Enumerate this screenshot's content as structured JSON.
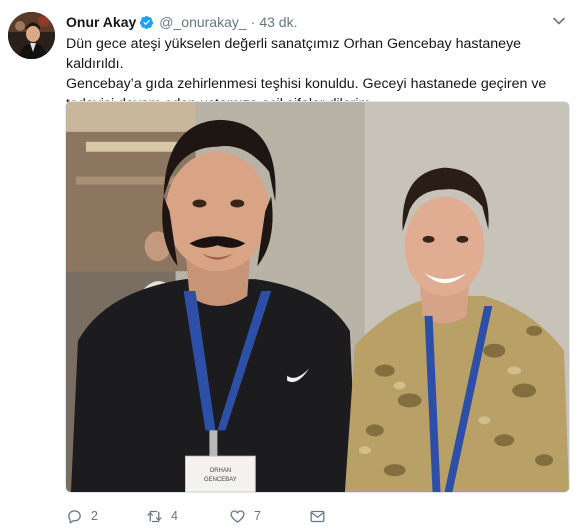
{
  "author": {
    "name": "Onur Akay",
    "handle": "@_onurakay_",
    "separator": "·",
    "time": "43 dk."
  },
  "tweet": {
    "lines": [
      "Dün gece ateşi yükselen değerli sanatçımız Orhan Gencebay hastaneye kaldırıldı.",
      "Gencebay’a gıda zehirlenmesi teşhisi konuldu. Geceyi hastanede geçiren ve",
      "tedavisi devam eden ustamıza acil şifalar dilerim."
    ]
  },
  "media": {
    "badge_lines": [
      "ORHAN",
      "GENCEBAY"
    ]
  },
  "actions": {
    "reply_count": "2",
    "retweet_count": "4",
    "like_count": "7"
  },
  "icons": {
    "verified": "verified-badge-icon",
    "caret": "chevron-down-icon",
    "reply": "reply-icon",
    "retweet": "retweet-icon",
    "like": "heart-icon",
    "dm": "envelope-icon"
  },
  "colors": {
    "verified": "#1da1f2",
    "muted": "#657786",
    "text": "#14171a"
  }
}
